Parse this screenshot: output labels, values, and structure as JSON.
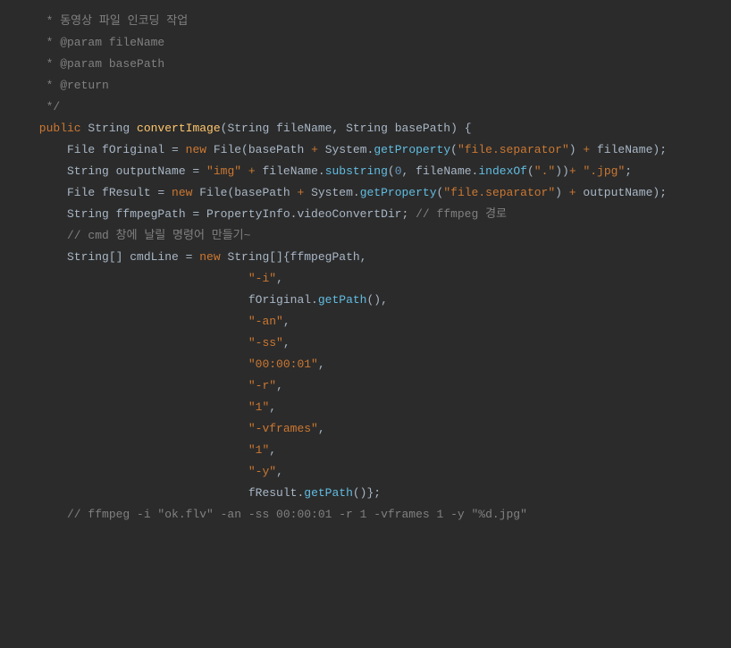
{
  "code": {
    "comment1": "  * 동영상 파일 인코딩 작업",
    "comment2": "  * @param fileName",
    "comment3": "  * @param basePath",
    "comment4": "  * @return",
    "comment5": "  */",
    "l6_public": " public",
    "l6_type": " String ",
    "l6_method": "convertImage",
    "l6_params": "(String fileName, String basePath) {",
    "blank": "",
    "l8_pre": "     File fOriginal = ",
    "l8_new": "new",
    "l8_file": " File(basePath ",
    "l8_plus1": "+",
    "l8_sys": " System.",
    "l8_getprop": "getProperty",
    "l8_open": "(",
    "l8_str": "\"file.separator\"",
    "l8_close": ") ",
    "l8_plus2": "+",
    "l8_fn": " fileName);",
    "l10_pre": "     String outputName = ",
    "l10_str1": "\"img\"",
    "l10_sp1": " ",
    "l10_plus1": "+",
    "l10_fn": " fileName.",
    "l10_substr": "substring",
    "l10_open": "(",
    "l10_zero": "0",
    "l10_comma": ", fileName.",
    "l10_indexof": "indexOf",
    "l10_open2": "(",
    "l10_dotstr": "\".\"",
    "l10_close": "))",
    "l10_plus2": "+",
    "l10_sp2": " ",
    "l10_jpgstr": "\".jpg\"",
    "l10_semi": ";",
    "l11_pre": "     File fResult = ",
    "l11_new": "new",
    "l11_file": " File(basePath ",
    "l11_plus1": "+",
    "l11_sys": " System.",
    "l11_getprop": "getProperty",
    "l11_open": "(",
    "l11_str": "\"file.separator\"",
    "l11_close": ") ",
    "l11_plus2": "+",
    "l11_out": " outputName);",
    "l13_pre": "     String ffmpegPath = PropertyInfo.videoConvertDir; ",
    "l13_cmt": "// ffmpeg 경로",
    "l15_cmt": "     // cmd 창에 날릴 명령어 만들기~",
    "l16_pre": "     String[] cmdLine = ",
    "l16_new": "new",
    "l16_rest": " String[]{ffmpegPath,",
    "pad": "                               ",
    "l17_s": "\"-i\"",
    "l17_c": ",",
    "l18_pre": "fOriginal.",
    "l18_gp": "getPath",
    "l18_rest": "(),",
    "l19_s": "\"-an\"",
    "l19_c": ",",
    "l20_s": "\"-ss\"",
    "l20_c": ",",
    "l21_s": "\"00:00:01\"",
    "l21_c": ",",
    "l22_s": "\"-r\"",
    "l22_c": ",",
    "l23_s": "\"1\"",
    "l23_c": ",",
    "l24_s": "\"-vframes\"",
    "l24_c": ",",
    "l25_s": "\"1\"",
    "l25_c": ",",
    "l26_s": "\"-y\"",
    "l26_c": ",",
    "l27_pre": "fResult.",
    "l27_gp": "getPath",
    "l27_rest": "()};",
    "l29_cmt": "     // ffmpeg -i \"ok.flv\" -an -ss 00:00:01 -r 1 -vframes 1 -y \"%d.jpg\""
  }
}
